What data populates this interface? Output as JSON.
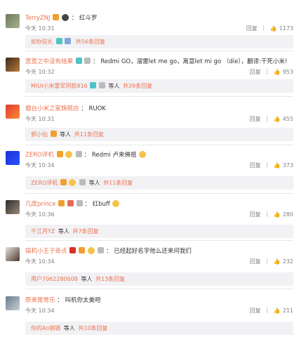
{
  "comments": [
    {
      "user": "TerryZNJ",
      "text": "红斗罗",
      "time": "今天 10:31",
      "reply_label": "回复",
      "likes": "1173",
      "replies": {
        "name": "如你驻扎",
        "deng": "",
        "link": "共56条回复"
      }
    },
    {
      "user": "寞寞之中没有结果",
      "text": "Redmi GO，溜雷let me go，离意let mi go （die），翻译:干死小米!",
      "time": "今天 10:32",
      "reply_label": "回复",
      "likes": "953",
      "replies": {
        "name": "MIUI小米雷军同款816",
        "deng": "等人",
        "link": "共39条回复"
      }
    },
    {
      "user": "烟台小米之家旗舰店",
      "text": "RUOK",
      "time": "今天 10:31",
      "reply_label": "回复",
      "likes": "455",
      "replies": {
        "name": "郭小仙",
        "deng": "等人",
        "link": "共11条回复"
      }
    },
    {
      "user": "ZERO评机",
      "text": "Redmi 卢来佛祖",
      "time": "今天 10:34",
      "reply_label": "回复",
      "likes": "373",
      "replies": {
        "name": "ZERO评机",
        "deng": "等人",
        "link": "共11条回复"
      }
    },
    {
      "user": "几度prince",
      "text": "红buff",
      "time": "今天 10:36",
      "reply_label": "回复",
      "likes": "280",
      "replies": {
        "name": "千江月YZ",
        "deng": "等人",
        "link": "共7条回复"
      }
    },
    {
      "user": "搞机小王子奇点",
      "text": "已经起好名字他么还来问我们",
      "time": "今天 10:34",
      "reply_label": "回复",
      "likes": "232",
      "replies": {
        "name": "用户7062280608",
        "deng": "等人",
        "link": "共13条回复"
      }
    },
    {
      "user": "原来是常乐",
      "text": "叫机你太美吧",
      "time": "今天 10:34",
      "reply_label": "回复",
      "likes": "211",
      "replies": {
        "name": "你的Ao锅锅",
        "deng": "等人",
        "link": "共10条回复"
      }
    }
  ],
  "colors": {
    "username": "#eb7350",
    "reply_bg": "#f2f2f5",
    "meta": "#808080"
  },
  "icons": {
    "like": "thumb-up-icon",
    "badge": "vip-badge-icon",
    "emoji": "emoji-icon"
  }
}
